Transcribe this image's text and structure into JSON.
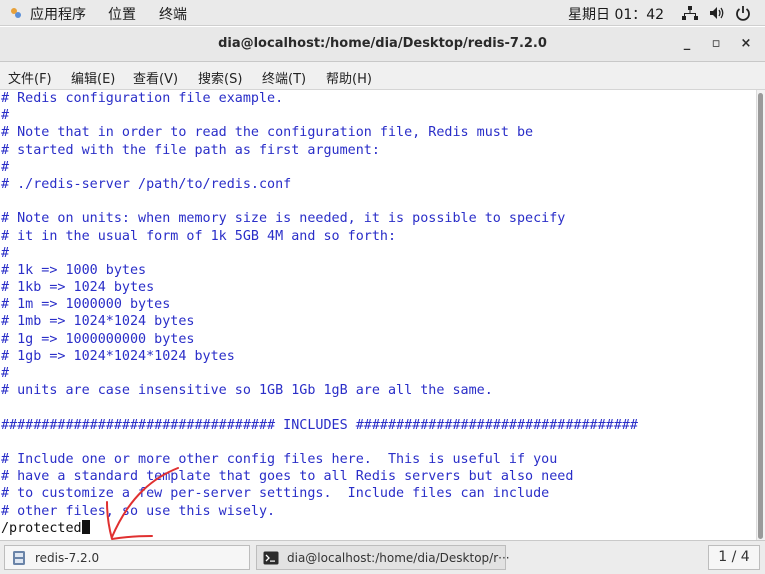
{
  "top_panel": {
    "applications": "应用程序",
    "places": "位置",
    "terminal": "终端",
    "clock": "星期日 01：42"
  },
  "window": {
    "title": "dia@localhost:/home/dia/Desktop/redis-7.2.0",
    "minimize": "_",
    "maximize": "▫",
    "close": "×"
  },
  "menubar": {
    "items": [
      "文件(F)",
      "编辑(E)",
      "查看(V)",
      "搜索(S)",
      "终端(T)",
      "帮助(H)"
    ]
  },
  "terminal": {
    "lines": [
      "# Redis configuration file example.",
      "#",
      "# Note that in order to read the configuration file, Redis must be",
      "# started with the file path as first argument:",
      "#",
      "# ./redis-server /path/to/redis.conf",
      "",
      "# Note on units: when memory size is needed, it is possible to specify",
      "# it in the usual form of 1k 5GB 4M and so forth:",
      "#",
      "# 1k => 1000 bytes",
      "# 1kb => 1024 bytes",
      "# 1m => 1000000 bytes",
      "# 1mb => 1024*1024 bytes",
      "# 1g => 1000000000 bytes",
      "# 1gb => 1024*1024*1024 bytes",
      "#",
      "# units are case insensitive so 1GB 1Gb 1gB are all the same.",
      "",
      "################################## INCLUDES ###################################",
      "",
      "# Include one or more other config files here.  This is useful if you",
      "# have a standard template that goes to all Redis servers but also need",
      "# to customize a few per-server settings.  Include files can include",
      "# other files, so use this wisely."
    ],
    "command": "/protected"
  },
  "taskbar": {
    "task1": "redis-7.2.0",
    "task2": "dia@localhost:/home/dia/Desktop/r···",
    "pager": "1 / 4"
  },
  "colors": {
    "comment": "#2a2ec8",
    "annotation": "#e03030"
  }
}
